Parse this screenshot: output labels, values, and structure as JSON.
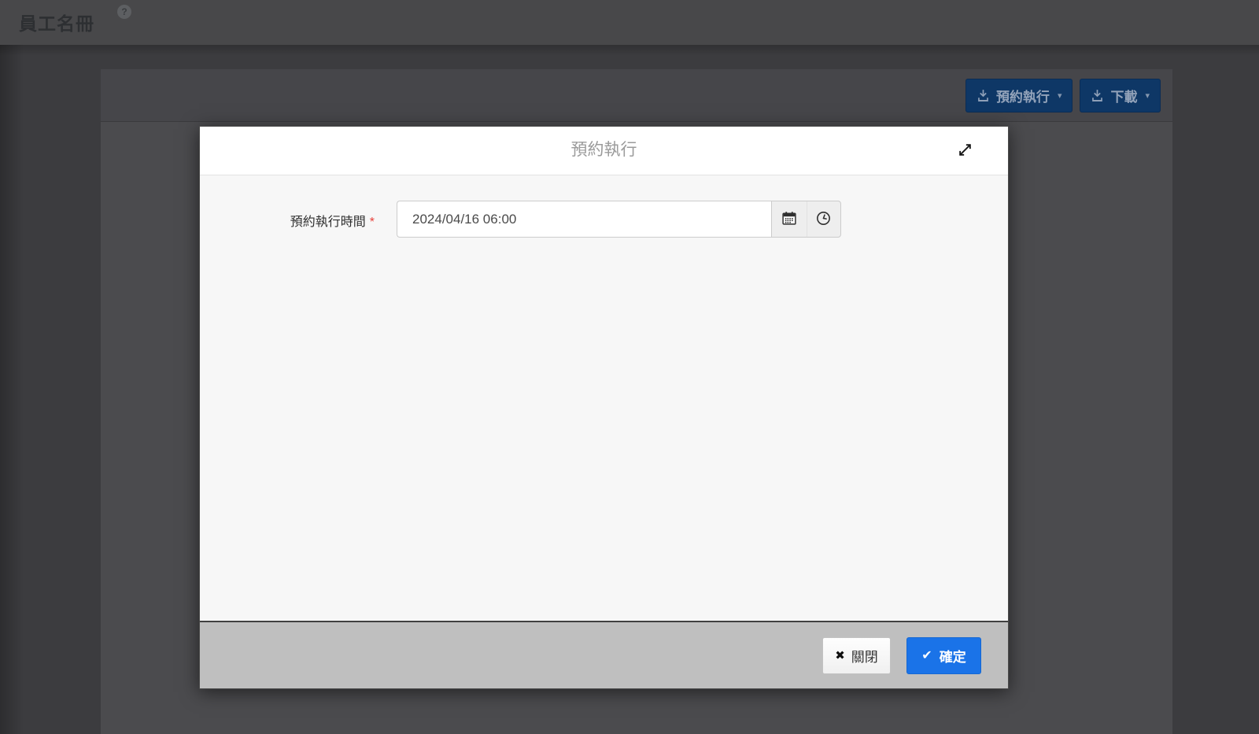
{
  "topbar": {
    "title": "員工名冊",
    "help_glyph": "?"
  },
  "panel_toolbar": {
    "schedule_label": "預約執行",
    "download_label": "下載",
    "caret_glyph": "▾"
  },
  "modal": {
    "title": "預約執行",
    "field": {
      "label": "預約執行時間",
      "required_mark": "*",
      "value": "2024/04/16 06:00"
    },
    "close_label": "關閉",
    "close_glyph": "✖",
    "confirm_label": "確定",
    "confirm_glyph": "✔"
  },
  "colors": {
    "confirm_blue": "#1a73e8",
    "toolbar_button_navy": "#0e3766",
    "required_red": "#e8403a",
    "footer_gray": "#bfbfbf",
    "backdrop_panel": "#4b4b4e",
    "modal_body": "#f7f7f7"
  }
}
